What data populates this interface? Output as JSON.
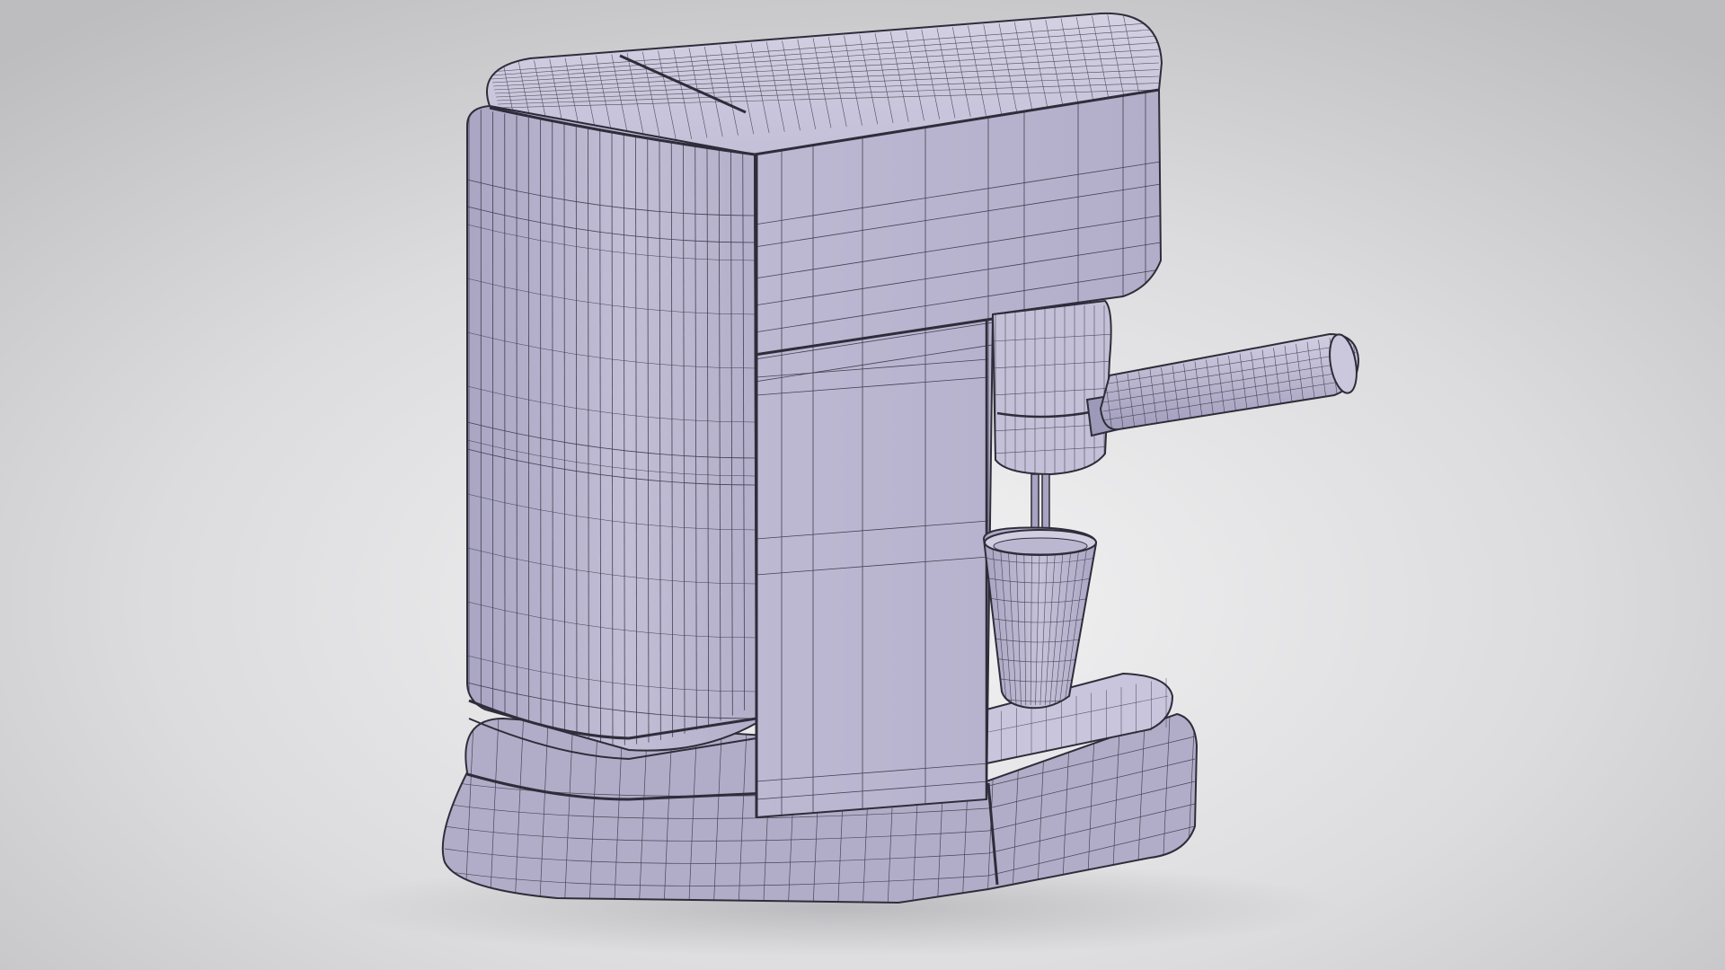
{
  "scene": {
    "subject": "",
    "colors": {
      "background_center": "#f3f3f4",
      "background_edge": "#bdbdc0",
      "surface": "#b7b3cd",
      "surface_light": "#cdc9de",
      "surface_dark": "#8e8aa8",
      "wire": "#2e2d3a"
    }
  }
}
